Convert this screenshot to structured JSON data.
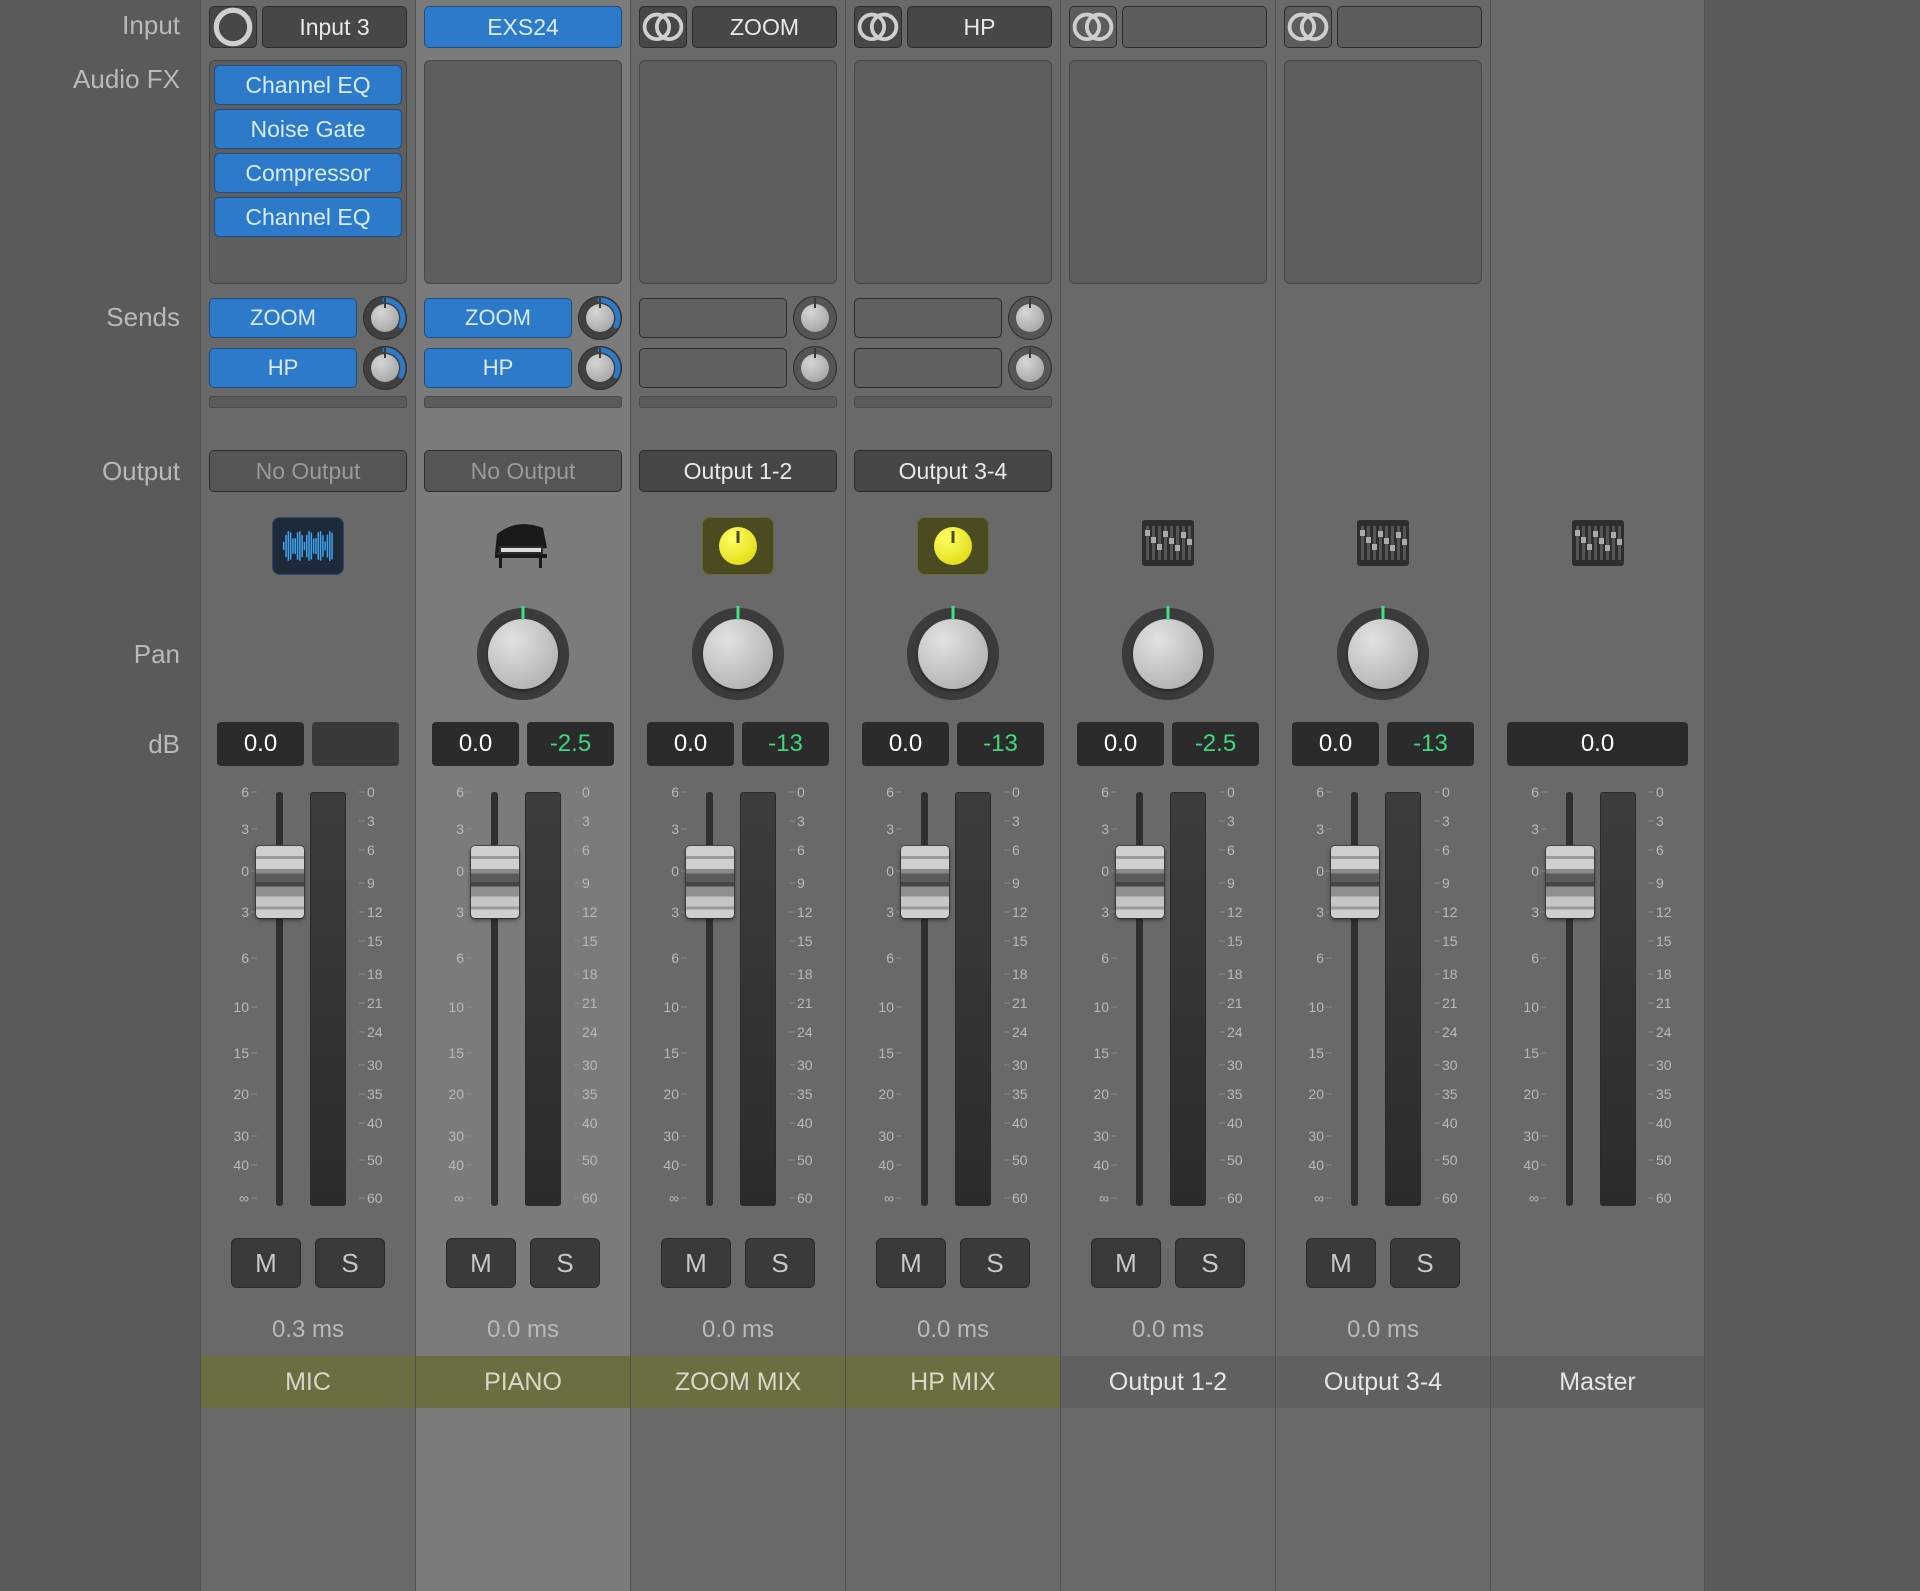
{
  "row_labels": {
    "input": "Input",
    "audio_fx": "Audio FX",
    "sends": "Sends",
    "output": "Output",
    "pan": "Pan",
    "db": "dB"
  },
  "fader_scale_left": [
    "6",
    "3",
    "0",
    "3",
    "6",
    "10",
    "15",
    "20",
    "30",
    "40",
    "∞"
  ],
  "fader_scale_right": [
    "0",
    "3",
    "6",
    "9",
    "12",
    "15",
    "18",
    "21",
    "24",
    "30",
    "35",
    "40",
    "50",
    "60"
  ],
  "strips": [
    {
      "id": "mic",
      "selected": false,
      "input_icon": "mono",
      "input_label": "Input 3",
      "input_style": "dark",
      "fx": [
        "Channel EQ",
        "Noise Gate",
        "Compressor",
        "Channel EQ"
      ],
      "sends": [
        {
          "label": "ZOOM",
          "arc": 0.55
        },
        {
          "label": "HP",
          "arc": 0.55
        }
      ],
      "send_empty_bar": true,
      "output": {
        "label": "No Output",
        "style": "dim2"
      },
      "track_icon": "waveform",
      "show_pan": false,
      "db": {
        "left": "0.0",
        "right": ""
      },
      "mute": "M",
      "solo": "S",
      "latency": "0.3 ms",
      "name": "MIC",
      "name_style": "olive"
    },
    {
      "id": "piano",
      "selected": true,
      "input_icon": null,
      "input_label": "EXS24",
      "input_style": "blue-full",
      "fx": [],
      "sends": [
        {
          "label": "ZOOM",
          "arc": 0.55
        },
        {
          "label": "HP",
          "arc": 0.55
        }
      ],
      "send_empty_bar": true,
      "output": {
        "label": "No Output",
        "style": "dim2"
      },
      "track_icon": "piano",
      "show_pan": true,
      "db": {
        "left": "0.0",
        "right": "-2.5"
      },
      "mute": "M",
      "solo": "S",
      "latency": "0.0 ms",
      "name": "PIANO",
      "name_style": "olive"
    },
    {
      "id": "zoommix",
      "selected": false,
      "input_icon": "stereo",
      "input_label": "ZOOM",
      "input_style": "dark",
      "fx": [],
      "sends": [
        {
          "empty": true
        },
        {
          "empty": true
        }
      ],
      "send_empty_bar": true,
      "output": {
        "label": "Output 1-2",
        "style": "dark"
      },
      "track_icon": "olive-knob",
      "show_pan": true,
      "db": {
        "left": "0.0",
        "right": "-13"
      },
      "mute": "M",
      "solo": "S",
      "latency": "0.0 ms",
      "name": "ZOOM MIX",
      "name_style": "olive"
    },
    {
      "id": "hpmix",
      "selected": false,
      "input_icon": "stereo",
      "input_label": "HP",
      "input_style": "dark",
      "fx": [],
      "sends": [
        {
          "empty": true
        },
        {
          "empty": true
        }
      ],
      "send_empty_bar": true,
      "output": {
        "label": "Output 3-4",
        "style": "dark"
      },
      "track_icon": "olive-knob",
      "show_pan": true,
      "db": {
        "left": "0.0",
        "right": "-13"
      },
      "mute": "M",
      "solo": "S",
      "latency": "0.0 ms",
      "name": "HP MIX",
      "name_style": "olive"
    },
    {
      "id": "out12",
      "selected": false,
      "input_icon": "stereo",
      "input_label": "",
      "input_style": "dim",
      "fx": [],
      "sends": [],
      "output": null,
      "track_icon": "mixer",
      "show_pan": true,
      "db": {
        "left": "0.0",
        "right": "-2.5"
      },
      "mute": "M",
      "solo": "S",
      "latency": "0.0 ms",
      "name": "Output 1-2",
      "name_style": "grey"
    },
    {
      "id": "out34",
      "selected": false,
      "input_icon": "stereo",
      "input_label": "",
      "input_style": "dim",
      "fx": [],
      "sends": [],
      "output": null,
      "track_icon": "mixer",
      "show_pan": true,
      "db": {
        "left": "0.0",
        "right": "-13"
      },
      "mute": "M",
      "solo": "S",
      "latency": "0.0 ms",
      "name": "Output 3-4",
      "name_style": "grey"
    },
    {
      "id": "master",
      "selected": false,
      "input_icon": null,
      "input_label": null,
      "input_style": null,
      "fx": null,
      "sends": null,
      "output": null,
      "track_icon": "mixer",
      "show_pan": false,
      "db": {
        "left": "0.0",
        "right": null,
        "single": true
      },
      "mute": null,
      "solo": null,
      "latency": "",
      "name": "Master",
      "name_style": "grey"
    }
  ]
}
